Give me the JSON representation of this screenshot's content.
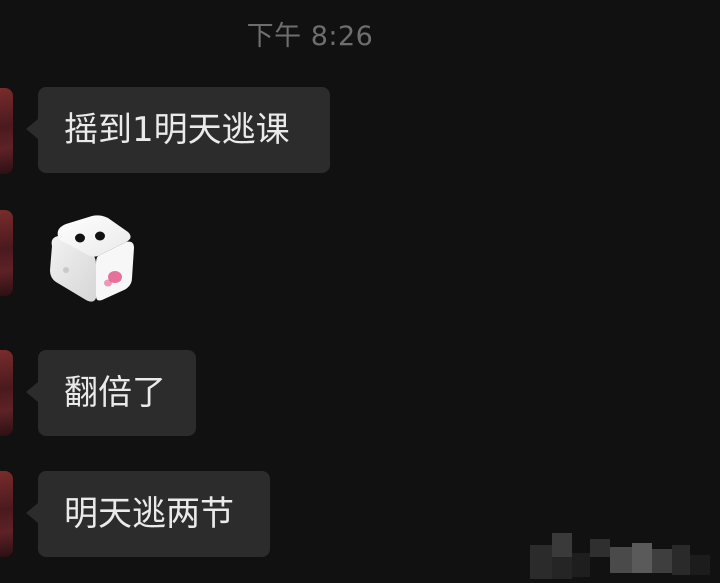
{
  "chat": {
    "timestamp": "下午 8:26",
    "messages": [
      {
        "type": "text",
        "text": "摇到1明天逃课"
      },
      {
        "type": "dice",
        "icon": "dice-icon",
        "face": 2
      },
      {
        "type": "text",
        "text": "翻倍了"
      },
      {
        "type": "text",
        "text": "明天逃两节"
      }
    ]
  },
  "colors": {
    "background": "#111111",
    "bubble": "#2c2c2c",
    "bubble_text": "#eaeaea",
    "timestamp_text": "#6e6e6e",
    "dice_body": "#ffffff",
    "dice_pip": "#111111",
    "dice_accent": "#e35a8c"
  }
}
